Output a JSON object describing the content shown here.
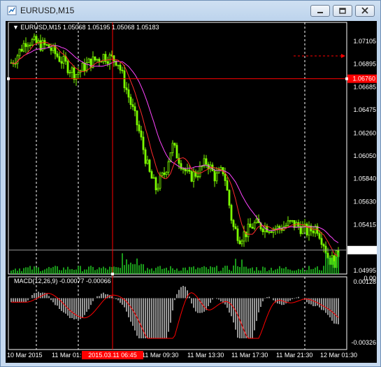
{
  "window": {
    "title": "EURUSD,M15",
    "icon": "chart-window-icon",
    "controls": [
      "minimize-icon",
      "restore-icon",
      "close-icon"
    ]
  },
  "chart": {
    "symbol_info": "EURUSD,M15  1.05068 1.05195 1.05068 1.05183",
    "indicator_info": "MACD(12,26,9) -0.00077 -0.00066",
    "price_levels": [
      "1.07105",
      "1.06895",
      "1.06685",
      "1.06475",
      "1.06260",
      "1.06050",
      "1.05840",
      "1.05630",
      "1.05415",
      "1.04995"
    ],
    "current_price": "1.05183",
    "crosshair_price": "1.06760",
    "indicator_levels": [
      "0.00128",
      "-0.00326"
    ],
    "indicator_zero": "0.00",
    "time_labels": [
      "10 Mar 2015",
      "11 Mar 01:",
      "11 Mar 09:30",
      "11 Mar 13:30",
      "11 Mar 17:30",
      "11 Mar 21:30",
      "12 Mar 01:30"
    ],
    "crosshair_time": "2015.03.11 06:45",
    "colors": {
      "background": "#000000",
      "candles": "#7cfc00",
      "fast_ma": "#ff2a2a",
      "slow_ma": "#ff44ff",
      "crosshair": "#ff0000",
      "histogram": "#c8c8c8",
      "signal": "#ff0000",
      "volume": "#22cc22"
    }
  }
}
